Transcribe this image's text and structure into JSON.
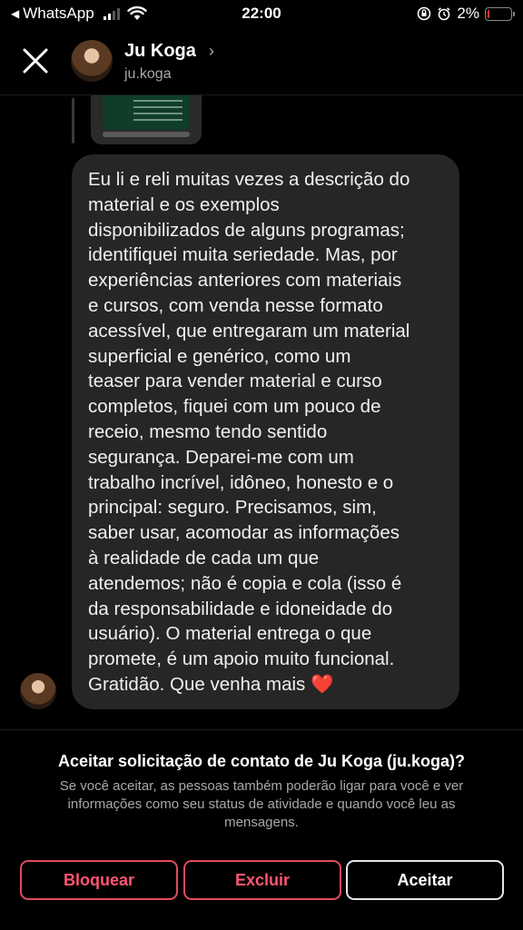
{
  "status_bar": {
    "back_app": "WhatsApp",
    "time": "22:00",
    "battery": "2%",
    "battery_level": 0.02,
    "battery_color": "#e0332f"
  },
  "header": {
    "name": "Ju Koga",
    "username": "ju.koga"
  },
  "message": {
    "lines": [
      "Eu li e reli muitas vezes a descrição do",
      "material e os exemplos",
      "disponibilizados de alguns programas;",
      "identifiquei muita seriedade. Mas, por",
      "experiências anteriores com materiais",
      "e cursos, com venda nesse formato",
      "acessível, que entregaram um material",
      "superficial e genérico, como um",
      "teaser para vender material e curso",
      "completos, fiquei com um pouco de",
      "receio, mesmo tendo sentido",
      "segurança. Deparei-me com um",
      "trabalho incrível, idôneo, honesto e o",
      "principal: seguro. Precisamos, sim,",
      "saber usar, acomodar as informações",
      "à realidade de cada um que",
      "atendemos; não é copia e cola (isso é",
      "da responsabilidade e idoneidade do",
      "usuário). O material entrega o que",
      "promete, é um apoio muito funcional.",
      "Gratidão. Que venha mais"
    ],
    "emoji": "❤️"
  },
  "request": {
    "title": "Aceitar solicitação de contato de Ju Koga (ju.koga)?",
    "description": "Se você aceitar, as pessoas também poderão ligar para você e ver informações como seu status de atividade e quando você leu as mensagens."
  },
  "buttons": {
    "block": "Bloquear",
    "delete": "Excluir",
    "accept": "Aceitar"
  },
  "colors": {
    "danger": "#ff5573",
    "bubble": "#262626",
    "background": "#000000"
  }
}
